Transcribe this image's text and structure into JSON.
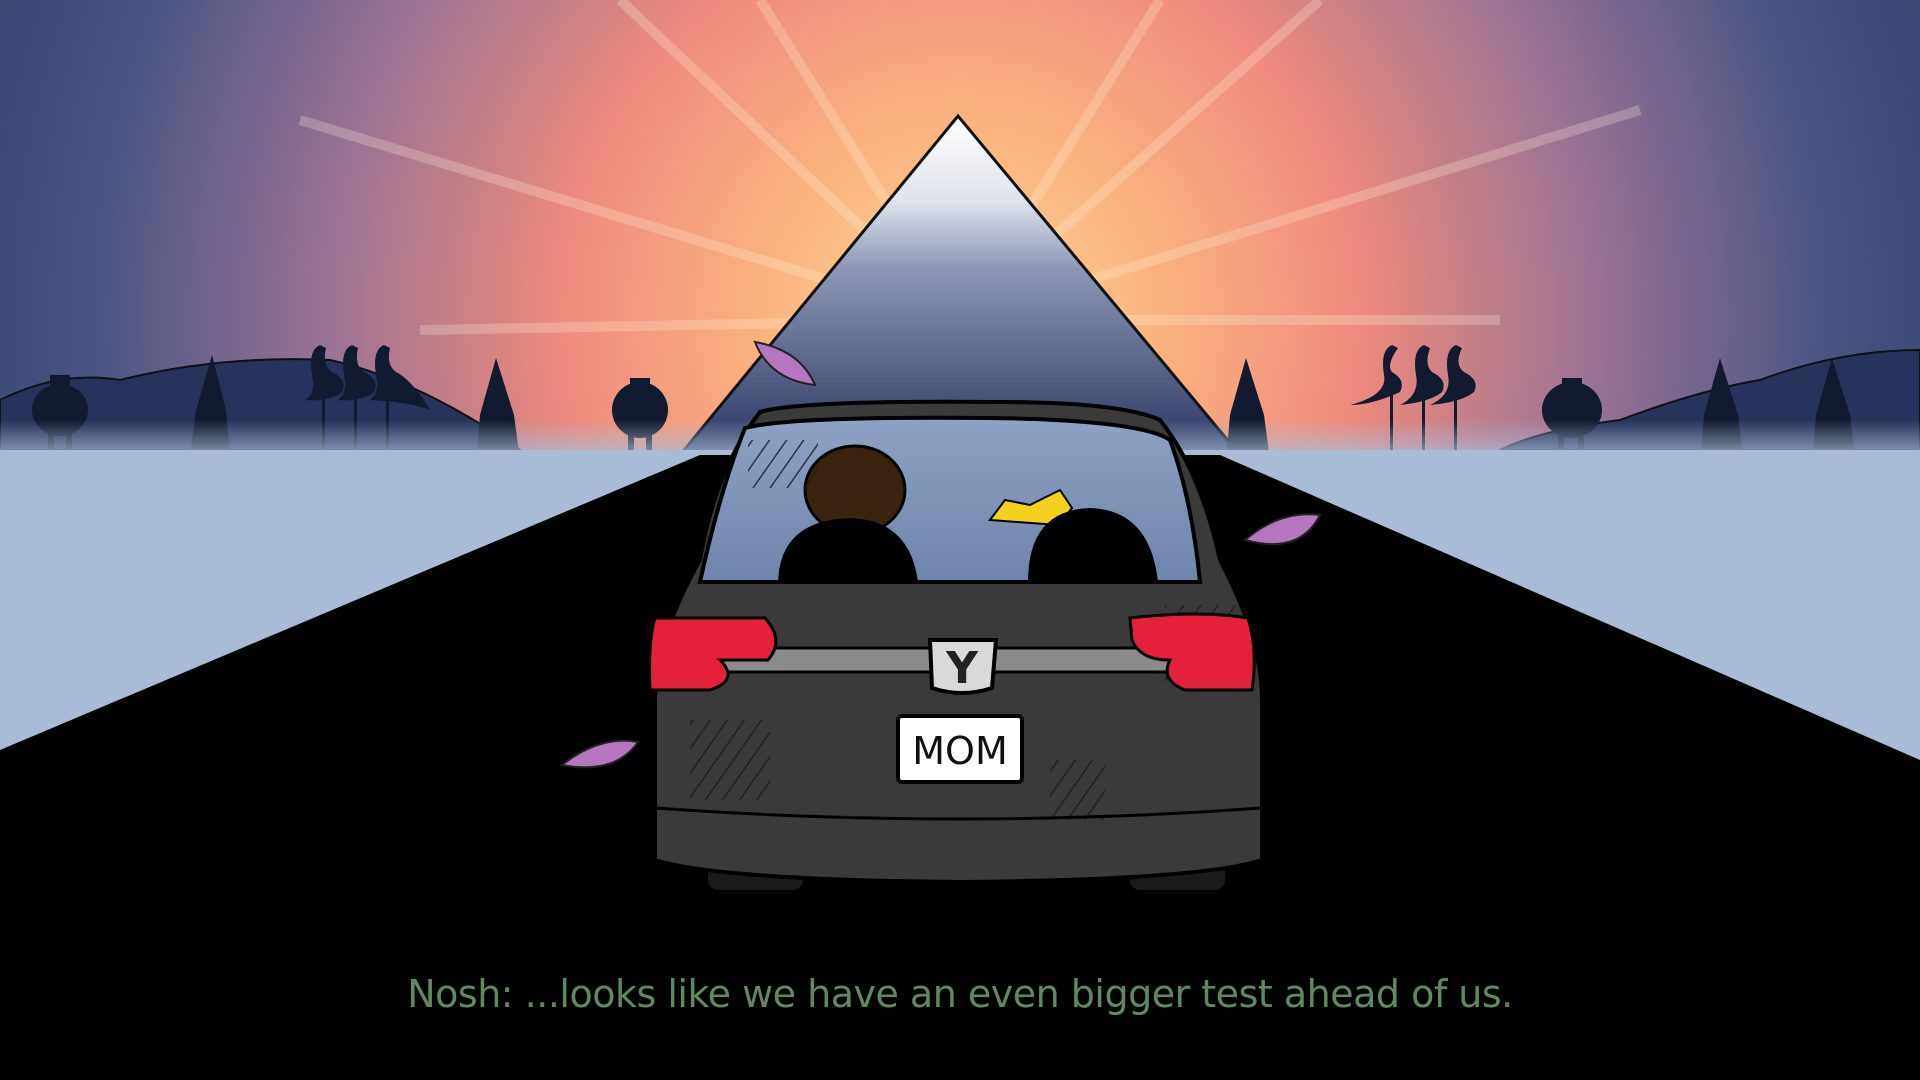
{
  "scene": {
    "license_plate": "MOM",
    "car_emblem": "Y",
    "characters": [
      "brown-haired-passenger",
      "blonde-haired-passenger"
    ]
  },
  "dialogue": {
    "line": "Nosh: ...looks like we have an even bigger test ahead of us."
  }
}
